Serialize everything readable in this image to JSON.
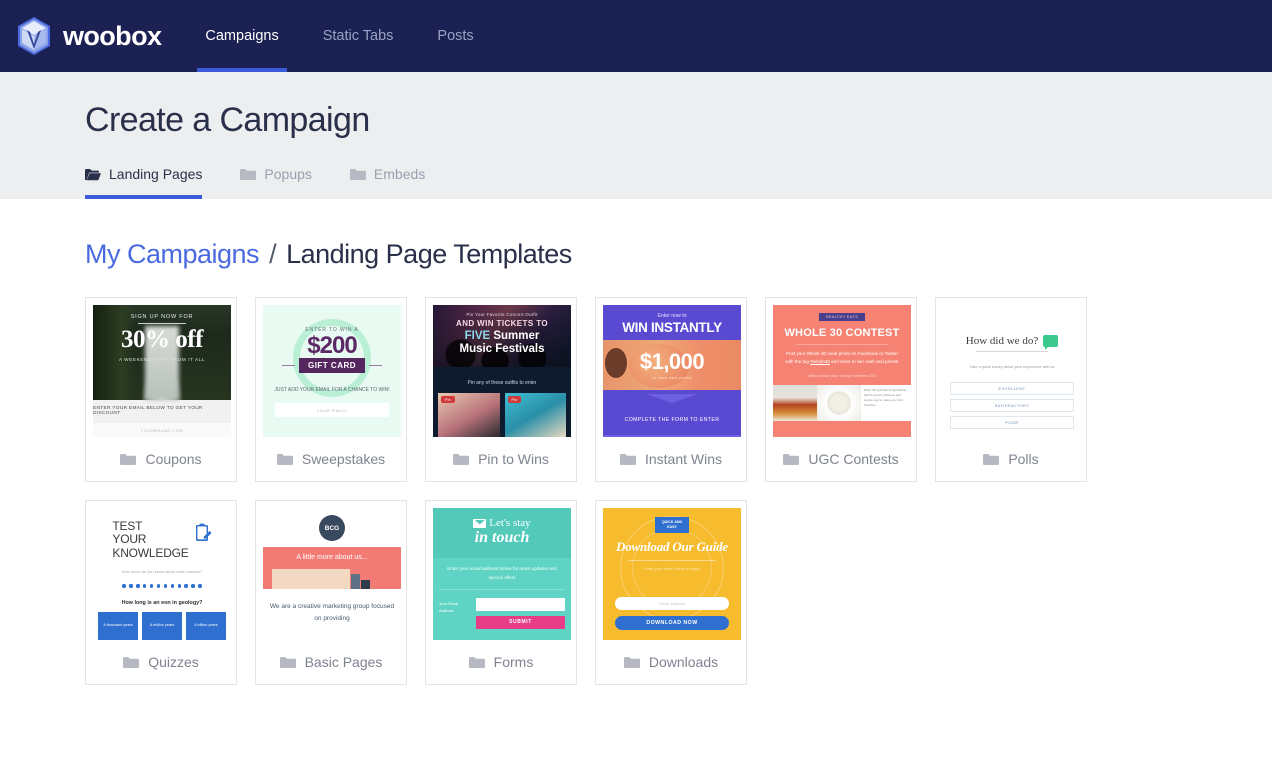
{
  "navbar": {
    "brand": "woobox",
    "brand_icon": "woobox-hexagon-logo",
    "items": [
      {
        "label": "Campaigns",
        "active": true
      },
      {
        "label": "Static Tabs",
        "active": false
      },
      {
        "label": "Posts",
        "active": false
      }
    ],
    "bg_color": "#1b2152",
    "accent_color": "#3b5bdb"
  },
  "page": {
    "title": "Create a Campaign",
    "tabs": [
      {
        "label": "Landing Pages",
        "icon": "open-folder-icon",
        "active": true
      },
      {
        "label": "Popups",
        "icon": "folder-icon",
        "active": false
      },
      {
        "label": "Embeds",
        "icon": "folder-icon",
        "active": false
      }
    ]
  },
  "breadcrumb": {
    "link": "My Campaigns",
    "separator": "/",
    "current": "Landing Page Templates",
    "link_color": "#4a6ae0"
  },
  "templates": [
    {
      "label": "Coupons",
      "icon": "folder-icon",
      "preview": {
        "eyebrow": "SIGN UP NOW FOR",
        "headline": "30% off",
        "tagline": "A WEEKEND AWAY FROM IT ALL",
        "strip": "ENTER YOUR EMAIL BELOW TO GET YOUR DISCOUNT",
        "footer": "YOURBRAND.COM"
      }
    },
    {
      "label": "Sweepstakes",
      "icon": "folder-icon",
      "preview": {
        "eyebrow": "ENTER TO WIN A",
        "amount": "$200",
        "badge": "GIFT CARD",
        "note": "JUST ADD YOUR EMAIL FOR A CHANCE TO WIN!",
        "input_placeholder": "YOUR EMAIL"
      }
    },
    {
      "label": "Pin to Wins",
      "icon": "folder-icon",
      "preview": {
        "eyebrow": "Pin Your Favorite Concert Outfit",
        "line1": "AND WIN TICKETS TO",
        "line2a": "FIVE",
        "line2b": "Summer",
        "line3": "Music Festivals",
        "subtitle": "Pin any of these outfits to enter",
        "pin_button": "Pin"
      }
    },
    {
      "label": "Instant Wins",
      "icon": "folder-icon",
      "preview": {
        "eyebrow": "Enter now to",
        "headline": "WIN INSTANTLY",
        "amount": "$1,000",
        "amount_sub": "in cash and prizes",
        "cta": "COMPLETE THE FORM TO ENTER"
      }
    },
    {
      "label": "UGC Contests",
      "icon": "folder-icon",
      "preview": {
        "badge": "HEALTHY EATS",
        "headline": "WHOLE 30 CONTEST",
        "body_a": "Post your Whole 30 meal photo on Facebook or Twitter with the tag ",
        "body_tag": "#whole30",
        "body_b": " and enter to win cash and prizes!",
        "note": "Voting will take place through November 2019",
        "caption": "Enter this gift based ingredients, fast fix and fit, delicious and simple way to make your first favorites."
      }
    },
    {
      "label": "Polls",
      "icon": "folder-icon",
      "preview": {
        "headline": "How did we do?",
        "subtitle": "Take a quick survey about your experience with us",
        "options": [
          "EXCELLENT",
          "SATISFACTORY",
          "POOR"
        ],
        "icon": "chat-bubble-icon"
      }
    },
    {
      "label": "Quizzes",
      "icon": "folder-icon",
      "preview": {
        "line1": "TEST",
        "line2": "YOUR",
        "line3": "KNOWLEDGE",
        "subtitle": "How much do you know about earth science?",
        "question": "How long is an eon in geology?",
        "answers": [
          "A thousand years",
          "A million years",
          "A billion years"
        ],
        "icon": "clipboard-pencil-icon",
        "dots": 12
      }
    },
    {
      "label": "Basic Pages",
      "icon": "folder-icon",
      "preview": {
        "logo": "BCG",
        "band": "A little more about us...",
        "body": "We are a creative marketing group focused on providing"
      }
    },
    {
      "label": "Forms",
      "icon": "folder-icon",
      "preview": {
        "line1": "Let's stay",
        "line2": "in touch",
        "body": "Enter your email address below for news updates and special offers",
        "field_label": "Your Email Address",
        "button": "SUBMIT",
        "icon": "envelope-icon"
      }
    },
    {
      "label": "Downloads",
      "icon": "folder-icon",
      "preview": {
        "badge_a": "QUICK AND",
        "badge_b": "EASY",
        "headline": "Download Our Guide",
        "subtitle": "Enter your email below to begin",
        "input_placeholder": "Email Address",
        "button": "DOWNLOAD NOW"
      }
    }
  ]
}
